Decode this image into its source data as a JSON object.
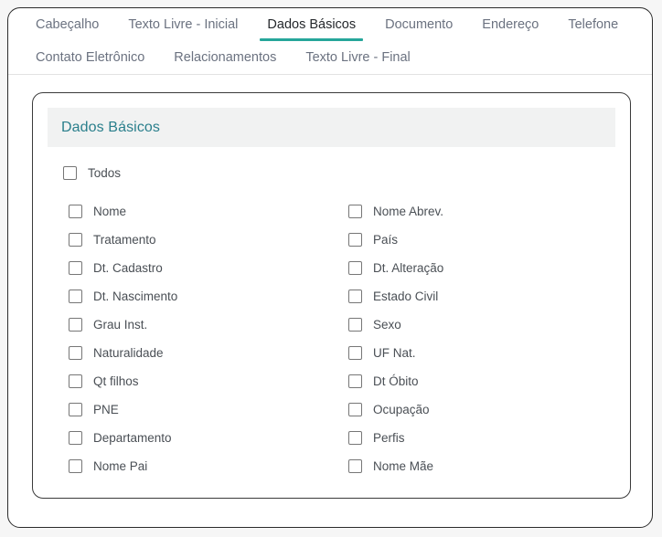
{
  "tabs": {
    "row1": [
      {
        "label": "Cabeçalho",
        "active": false
      },
      {
        "label": "Texto Livre - Inicial",
        "active": false
      },
      {
        "label": "Dados Básicos",
        "active": true
      },
      {
        "label": "Documento",
        "active": false
      },
      {
        "label": "Endereço",
        "active": false
      },
      {
        "label": "Telefone",
        "active": false
      }
    ],
    "row2": [
      {
        "label": "Contato Eletrônico",
        "active": false
      },
      {
        "label": "Relacionamentos",
        "active": false
      },
      {
        "label": "Texto Livre - Final",
        "active": false
      }
    ],
    "active_indicator_color": "#26a69a"
  },
  "panel": {
    "title": "Dados Básicos",
    "title_color": "#2a7f8c",
    "header_background": "#f1f2f2",
    "select_all": {
      "label": "Todos",
      "checked": false
    },
    "fields": [
      {
        "left": {
          "label": "Nome",
          "checked": false
        },
        "right": {
          "label": "Nome Abrev.",
          "checked": false
        }
      },
      {
        "left": {
          "label": "Tratamento",
          "checked": false
        },
        "right": {
          "label": "País",
          "checked": false
        }
      },
      {
        "left": {
          "label": "Dt. Cadastro",
          "checked": false
        },
        "right": {
          "label": "Dt. Alteração",
          "checked": false
        }
      },
      {
        "left": {
          "label": "Dt. Nascimento",
          "checked": false
        },
        "right": {
          "label": "Estado Civil",
          "checked": false
        }
      },
      {
        "left": {
          "label": "Grau Inst.",
          "checked": false
        },
        "right": {
          "label": "Sexo",
          "checked": false
        }
      },
      {
        "left": {
          "label": "Naturalidade",
          "checked": false
        },
        "right": {
          "label": "UF Nat.",
          "checked": false
        }
      },
      {
        "left": {
          "label": "Qt filhos",
          "checked": false
        },
        "right": {
          "label": "Dt Óbito",
          "checked": false
        }
      },
      {
        "left": {
          "label": "PNE",
          "checked": false
        },
        "right": {
          "label": "Ocupação",
          "checked": false
        }
      },
      {
        "left": {
          "label": "Departamento",
          "checked": false
        },
        "right": {
          "label": "Perfis",
          "checked": false
        }
      },
      {
        "left": {
          "label": "Nome Pai",
          "checked": false
        },
        "right": {
          "label": "Nome Mãe",
          "checked": false
        }
      }
    ]
  }
}
